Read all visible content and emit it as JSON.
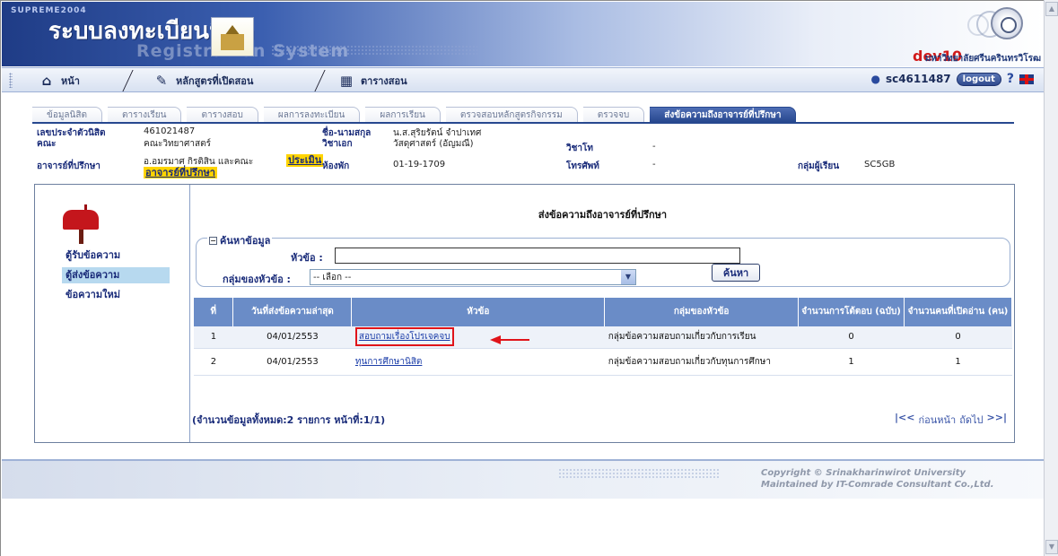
{
  "header": {
    "brand_small": "SUPREME2004",
    "title": "ระบบลงทะเบียนนิสิต",
    "subtitle": "Registration System",
    "env": "dev10",
    "university": "มหาวิทยาลัยศรีนครินทรวิโรฒ"
  },
  "nav": {
    "items": [
      {
        "label": "หน้า",
        "icon": "home-icon"
      },
      {
        "label": "หลักสูตรที่เปิดสอน",
        "icon": "course-icon"
      },
      {
        "label": "ตารางสอน",
        "icon": "timetable-icon"
      }
    ],
    "user_id": "sc4611487",
    "logout": "logout"
  },
  "tabs": [
    "ข้อมูลนิสิต",
    "ตารางเรียน",
    "ตารางสอบ",
    "ผลการลงทะเบียน",
    "ผลการเรียน",
    "ตรวจสอบหลักสูตรกิจกรรม",
    "ตรวจจบ",
    "ส่งข้อความถึงอาจารย์ที่ปรึกษา"
  ],
  "info": {
    "student_id_label": "เลขประจำตัวนิสิต",
    "student_id": "461021487",
    "faculty_label": "คณะ",
    "faculty": "คณะวิทยาศาสตร์",
    "advisor_label": "อาจารย์ที่ปรึกษา",
    "advisor": "อ.อมรมาศ กิรติสิน และคณะ",
    "evaluate_line1": "ประเมิน",
    "evaluate_line2": "อาจารย์ที่ปรึกษา",
    "name_label": "ชื่อ-นามสกุล",
    "name": "น.ส.สุริยรัตน์ จำปาเทศ",
    "major_label": "วิชาเอก",
    "major": "วัสดุศาสตร์ (อัญมณี)",
    "room_label": "ห้องพัก",
    "room": "01-19-1709",
    "minor_label": "วิชาโท",
    "minor": "-",
    "phone_label": "โทรศัพท์",
    "phone": "-",
    "group_label": "กลุ่มผู้เรียน",
    "group": "SC5GB"
  },
  "sidebar": {
    "items": [
      "ตู้รับข้อความ",
      "ตู้ส่งข้อความ",
      "ข้อความใหม่"
    ]
  },
  "content": {
    "title": "ส่งข้อความถึงอาจารย์ที่ปรึกษา",
    "search_legend": "ค้นหาข้อมูล",
    "subject_label": "หัวข้อ :",
    "subject_value": "",
    "group_label": "กลุ่มของหัวข้อ :",
    "group_value": "-- เลือก --",
    "search_button": "ค้นหา"
  },
  "table": {
    "headers": [
      "ที่",
      "วันที่ส่งข้อความล่าสุด",
      "หัวข้อ",
      "กลุ่มของหัวข้อ",
      "จำนวนการโต้ตอบ (ฉบับ)",
      "จำนวนคนที่เปิดอ่าน (คน)"
    ],
    "rows": [
      {
        "no": "1",
        "date": "04/01/2553",
        "subject": "สอบถามเรื่องโปรเจคจบ",
        "group": "กลุ่มข้อความสอบถามเกี่ยวกับการเรียน",
        "replies": "0",
        "readers": "0"
      },
      {
        "no": "2",
        "date": "04/01/2553",
        "subject": "ทุนการศึกษานิสิต",
        "group": "กลุ่มข้อความสอบถามเกี่ยวกับทุนการศึกษา",
        "replies": "1",
        "readers": "1"
      }
    ]
  },
  "pager": {
    "summary": "(จำนวนข้อมูลทั้งหมด:2 รายการ หน้าที่:1/1)",
    "first": "|<<",
    "prev": "ก่อนหน้า",
    "next": "ถัดไป",
    "last": ">>|"
  },
  "footer": {
    "copyright": "Copyright © Srinakharinwirot University",
    "maintained": "Maintained by IT-Comrade Consultant Co.,Ltd."
  },
  "colors": {
    "highlight_border": "#e0141a",
    "tab_active": "#27488f",
    "table_header": "#6a8cc7"
  }
}
